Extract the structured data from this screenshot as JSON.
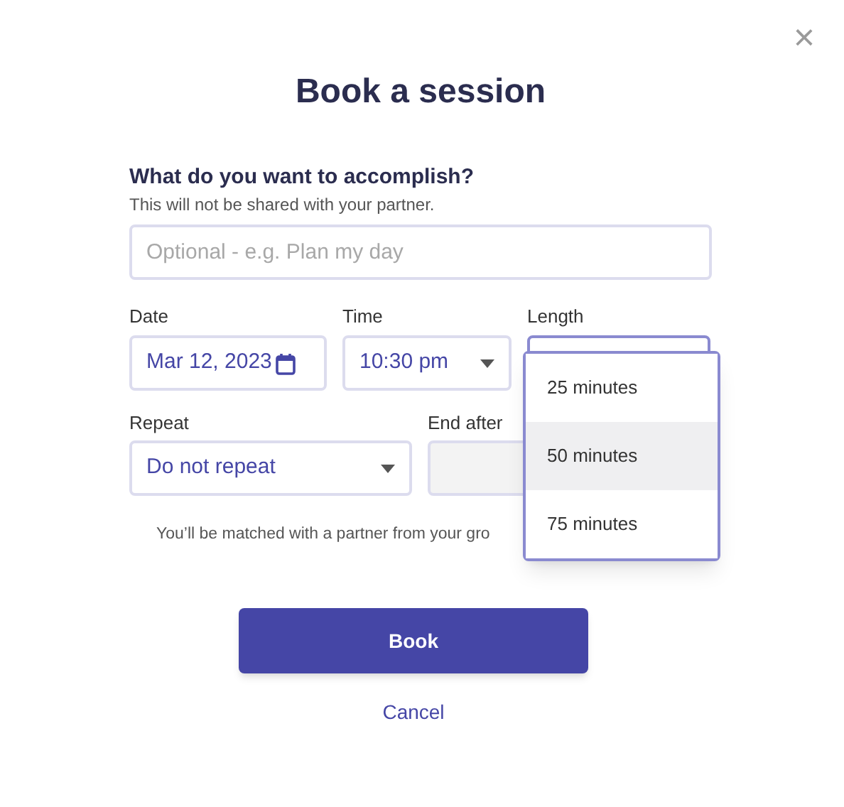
{
  "close": {
    "label": "×"
  },
  "title": "Book a session",
  "goal": {
    "heading": "What do you want to accomplish?",
    "hint": "This will not be shared with your partner.",
    "placeholder": "Optional - e.g. Plan my day"
  },
  "date": {
    "label": "Date",
    "value": "Mar 12, 2023"
  },
  "time": {
    "label": "Time",
    "value": "10:30 pm"
  },
  "length": {
    "label": "Length",
    "expanded": true,
    "options": [
      {
        "label": "25 minutes",
        "highlighted": false
      },
      {
        "label": "50 minutes",
        "highlighted": true
      },
      {
        "label": "75 minutes",
        "highlighted": false
      }
    ]
  },
  "repeat": {
    "label": "Repeat",
    "value": "Do not repeat"
  },
  "end_after": {
    "label": "End after",
    "disabled": true
  },
  "note": "You’ll be matched with a partner from your gro",
  "book_button": "Book",
  "cancel_link": "Cancel"
}
